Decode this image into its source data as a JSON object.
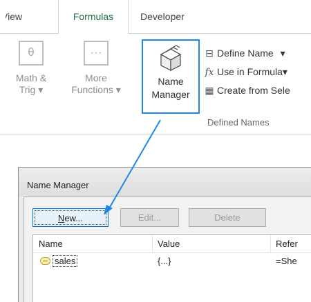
{
  "tabs": {
    "view": "View",
    "formulas": "Formulas",
    "developer": "Developer"
  },
  "ribbon": {
    "math_label_1": "Math &",
    "math_label_2": "Trig",
    "more_label_1": "More",
    "more_label_2": "Functions",
    "name_manager_1": "Name",
    "name_manager_2": "Manager",
    "define_name": "Define Name",
    "use_in_formula": "Use in Formula",
    "create_from_selection": "Create from Sele",
    "group_label": "Defined Names",
    "dropdown_glyph": "▾",
    "accent_color": "#1f86e8"
  },
  "dialog": {
    "title": "Name Manager",
    "buttons": {
      "new": "New...",
      "edit": "Edit...",
      "delete": "Delete"
    },
    "columns": {
      "name": "Name",
      "value": "Value",
      "refers": "Refer"
    },
    "rows": [
      {
        "name": "sales",
        "value": "{...}",
        "refers": "=She"
      }
    ]
  }
}
